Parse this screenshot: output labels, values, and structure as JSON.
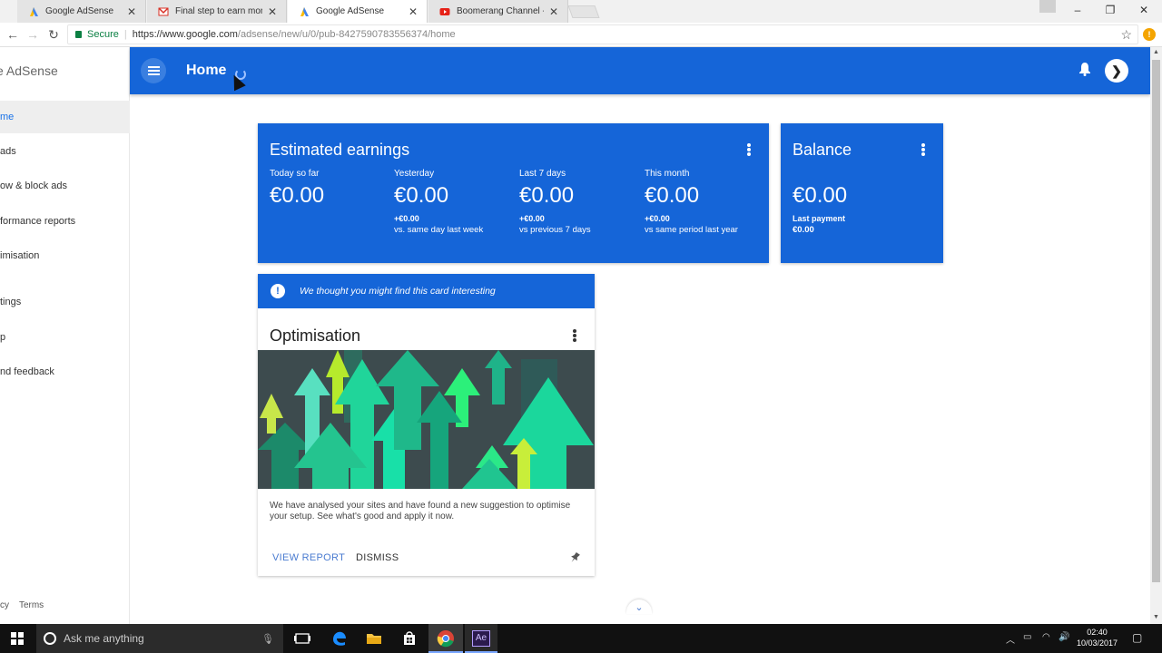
{
  "browser": {
    "tabs": [
      {
        "title": "Google AdSense",
        "icon": "adsense-favicon",
        "active": false
      },
      {
        "title": "Final step to earn money",
        "icon": "gmail-favicon",
        "active": false
      },
      {
        "title": "Google AdSense",
        "icon": "adsense-favicon",
        "active": true
      },
      {
        "title": "Boomerang Channel - Yo",
        "icon": "youtube-favicon",
        "active": false
      }
    ],
    "close_glyph": "✕",
    "secure_label": "Secure",
    "url_host": "https://www.google.com",
    "url_path": "/adsense/new/u/0/pub-8427590783556374/home",
    "extension_badge": "!"
  },
  "app": {
    "brand": "e AdSense",
    "page_title": "Home",
    "avatar_glyph": "❯",
    "nav": [
      {
        "label": "me",
        "active": true
      },
      {
        "label": " ads",
        "active": false
      },
      {
        "label": "ow & block ads",
        "active": false
      },
      {
        "label": "formance reports",
        "active": false
      },
      {
        "label": "imisation",
        "active": false
      },
      {
        "label": "tings",
        "active": false
      },
      {
        "label": "p",
        "active": false
      },
      {
        "label": "nd feedback",
        "active": false
      }
    ],
    "footer": {
      "privacy": "cy",
      "terms": "Terms"
    }
  },
  "earnings_card": {
    "title": "Estimated earnings",
    "metrics": [
      {
        "label": "Today so far",
        "value": "€0.00",
        "delta": "",
        "note": ""
      },
      {
        "label": "Yesterday",
        "value": "€0.00",
        "delta": "+€0.00",
        "note": "vs. same day last week"
      },
      {
        "label": "Last 7 days",
        "value": "€0.00",
        "delta": "+€0.00",
        "note": "vs previous 7 days"
      },
      {
        "label": "This month",
        "value": "€0.00",
        "delta": "+€0.00",
        "note": "vs same period last year"
      }
    ]
  },
  "balance_card": {
    "title": "Balance",
    "value": "€0.00",
    "last_payment_label": "Last payment",
    "last_payment_value": "€0.00"
  },
  "optimisation_card": {
    "banner": "We thought you might find this card interesting",
    "banner_icon": "!",
    "title": "Optimisation",
    "text": "We have analysed your sites and have found a new suggestion to optimise your setup. See what's good and apply it now.",
    "view_report": "VIEW REPORT",
    "dismiss": "DISMISS"
  },
  "scroll_down_glyph": "⌄",
  "taskbar": {
    "search_placeholder": "Ask me anything",
    "time": "02:40",
    "date": "10/03/2017",
    "ae_label": "Ae"
  },
  "colors": {
    "accent": "#1565d8",
    "link": "#4a7bd0"
  }
}
